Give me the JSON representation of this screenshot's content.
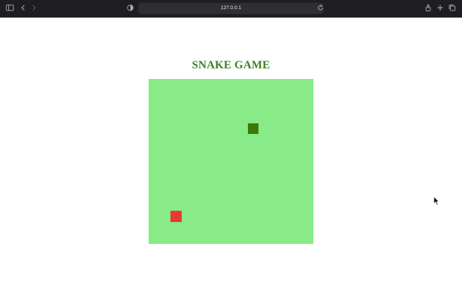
{
  "browser": {
    "url": "127.0.0.1",
    "icons": [
      "sidebar-icon",
      "back-icon",
      "forward-icon",
      "privacy-shield-icon",
      "reload-icon",
      "share-icon",
      "new-tab-icon",
      "tabs-overview-icon"
    ]
  },
  "game": {
    "title": "SNAKE GAME",
    "board_color": "#88eb88",
    "grid_cols": 15,
    "grid_rows": 15,
    "snake": {
      "color": "#3a7a07",
      "cells": [
        [
          9,
          4
        ]
      ]
    },
    "food": {
      "color": "#e53a2f",
      "cell": [
        2,
        12
      ]
    }
  }
}
